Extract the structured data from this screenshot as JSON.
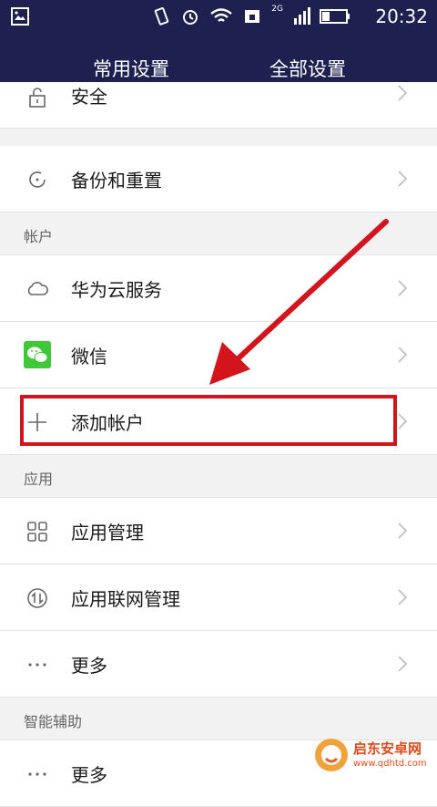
{
  "status_bar": {
    "time": "20:32",
    "network": "2G"
  },
  "tabs": {
    "common": "常用设置",
    "all": "全部设置"
  },
  "items": {
    "security": "安全",
    "backup": "备份和重置",
    "account_section": "帐户",
    "huawei_cloud": "华为云服务",
    "wechat": "微信",
    "add_account": "添加帐户",
    "apps_section": "应用",
    "app_manage": "应用管理",
    "app_network": "应用联网管理",
    "more1": "更多",
    "assist_section": "智能辅助",
    "more2": "更多"
  },
  "colors": {
    "header": "#1e2050",
    "highlight": "#d3141c",
    "wechat": "#3ec83a"
  },
  "watermark": {
    "title": "启东安卓网",
    "url": "www.qdhtd.com"
  }
}
